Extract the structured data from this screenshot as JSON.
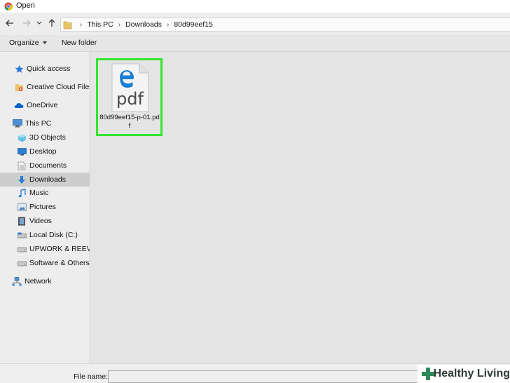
{
  "window": {
    "title": "Open"
  },
  "address": {
    "crumbs": [
      "This PC",
      "Downloads",
      "80d99eef15"
    ]
  },
  "toolbar": {
    "organize_label": "Organize",
    "new_folder_label": "New folder"
  },
  "sidebar": {
    "items": [
      {
        "label": "Quick access",
        "icon": "star-icon"
      },
      {
        "label": "Creative Cloud Files",
        "icon": "creative-cloud-icon"
      },
      {
        "label": "OneDrive",
        "icon": "onedrive-icon"
      },
      {
        "label": "This PC",
        "icon": "computer-icon"
      },
      {
        "label": "3D Objects",
        "icon": "cube-icon"
      },
      {
        "label": "Desktop",
        "icon": "desktop-icon"
      },
      {
        "label": "Documents",
        "icon": "documents-icon"
      },
      {
        "label": "Downloads",
        "icon": "download-arrow-icon",
        "selected": true
      },
      {
        "label": "Music",
        "icon": "music-note-icon"
      },
      {
        "label": "Pictures",
        "icon": "pictures-icon"
      },
      {
        "label": "Videos",
        "icon": "film-icon"
      },
      {
        "label": "Local Disk (C:)",
        "icon": "drive-icon"
      },
      {
        "label": "UPWORK & REEVIO",
        "icon": "drive-icon"
      },
      {
        "label": "Software & Others (",
        "icon": "drive-icon"
      },
      {
        "label": "Network",
        "icon": "network-icon"
      }
    ]
  },
  "files": [
    {
      "name": "80d99eef15-p-01.pdf",
      "icon_text": "pdf",
      "icon": "edge-pdf-icon",
      "selected": true
    }
  ],
  "bottom": {
    "file_name_label": "File name:",
    "file_name_value": ""
  },
  "watermark": {
    "text": "Healthy Living"
  },
  "colors": {
    "selection_border": "#33e52d",
    "edge_blue": "#1a7ed4",
    "background": "#e4e4e4",
    "watermark_green": "#2e8b57"
  }
}
